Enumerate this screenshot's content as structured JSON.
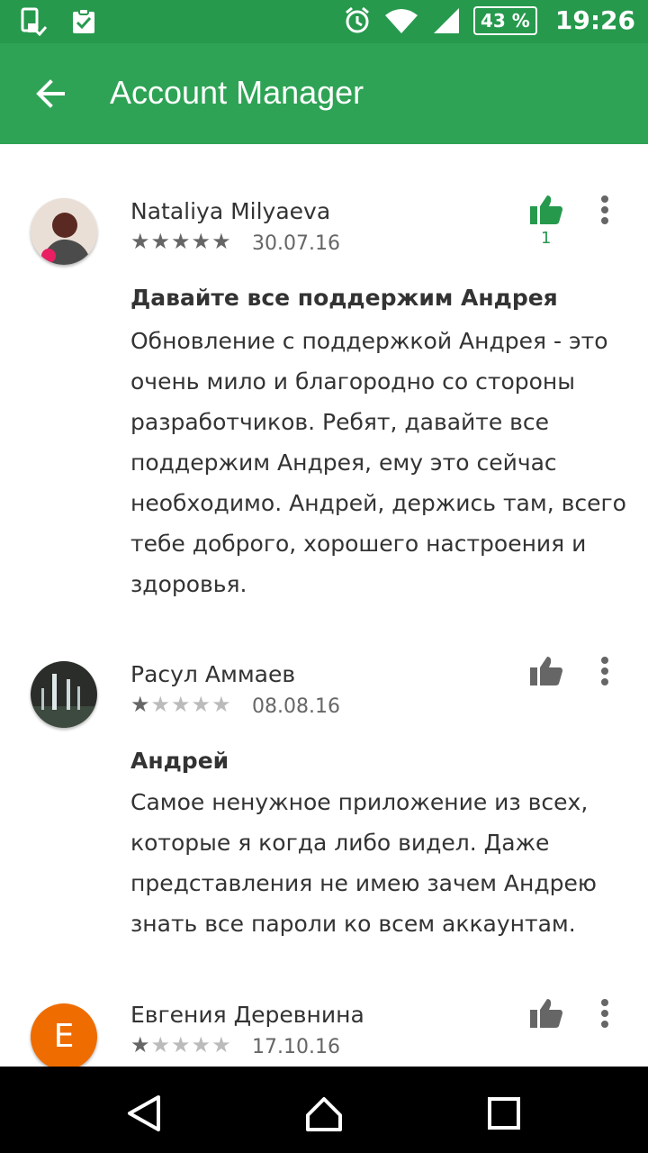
{
  "status_bar": {
    "battery": "43 %",
    "time": "19:26"
  },
  "app_bar": {
    "title": "Account Manager"
  },
  "reviews": [
    {
      "author": "Nataliya Milyaeva",
      "rating": 5,
      "date": "30.07.16",
      "likes": "1",
      "liked": true,
      "title": "Давайте все поддержим Андрея",
      "body": "Обновление с поддержкой Андрея - это очень мило и благородно со стороны разработчиков. Ребят, давайте все поддержим Андрея, ему это сейчас необходимо. Андрей, держись там, всего тебе доброго, хорошего настроения и здоровья."
    },
    {
      "author": "Расул Аммаев",
      "rating": 1,
      "date": "08.08.16",
      "title": "Андрей",
      "body": "Самое ненужное приложение из всех, которые я когда либо видел. Даже представления не имею зачем Андрею знать все пароли ко всем аккаунтам."
    },
    {
      "author": "Евгения Деревнина",
      "rating": 1,
      "date": "17.10.16",
      "avatar_letter": "E",
      "avatar_color": "#ef6c00"
    }
  ],
  "colors": {
    "accent": "#2ea355",
    "like_active": "#26994d"
  }
}
